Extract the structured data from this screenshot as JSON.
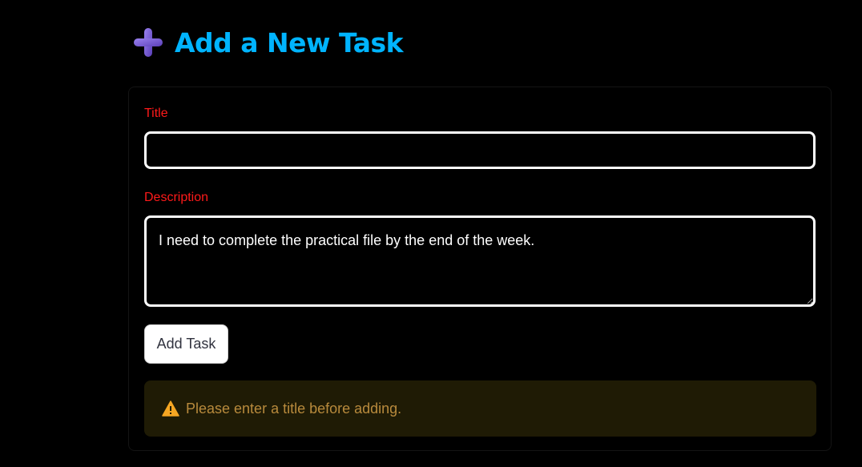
{
  "header": {
    "icon": "plus-icon",
    "title": "Add a New Task"
  },
  "form": {
    "title_label": "Title",
    "title_value": "",
    "description_label": "Description",
    "description_value": "I need to complete the practical file by the end of the week.",
    "submit_label": "Add Task"
  },
  "alert": {
    "icon": "warning-icon",
    "message": "Please enter a title before adding."
  },
  "colors": {
    "title": "#00b4ff",
    "label": "#ff1a1a",
    "warning_background": "#1f1b05",
    "warning_text": "#b88a3c",
    "plus_icon": "#7b5cd6"
  }
}
